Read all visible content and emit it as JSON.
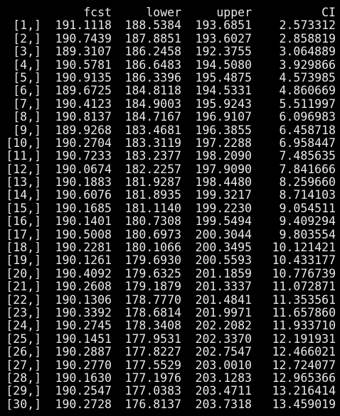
{
  "console": {
    "headers": [
      "",
      "fcst",
      "lower",
      "upper",
      "CI"
    ],
    "rows": [
      [
        "[1,]",
        "191.1118",
        "188.5384",
        "193.6851",
        "2.573312"
      ],
      [
        "[2,]",
        "190.7439",
        "187.8851",
        "193.6027",
        "2.858819"
      ],
      [
        "[3,]",
        "189.3107",
        "186.2458",
        "192.3755",
        "3.064889"
      ],
      [
        "[4,]",
        "190.5781",
        "186.6483",
        "194.5080",
        "3.929866"
      ],
      [
        "[5,]",
        "190.9135",
        "186.3396",
        "195.4875",
        "4.573985"
      ],
      [
        "[6,]",
        "189.6725",
        "184.8118",
        "194.5331",
        "4.860669"
      ],
      [
        "[7,]",
        "190.4123",
        "184.9003",
        "195.9243",
        "5.511997"
      ],
      [
        "[8,]",
        "190.8137",
        "184.7167",
        "196.9107",
        "6.096983"
      ],
      [
        "[9,]",
        "189.9268",
        "183.4681",
        "196.3855",
        "6.458718"
      ],
      [
        "[10,]",
        "190.2704",
        "183.3119",
        "197.2288",
        "6.958447"
      ],
      [
        "[11,]",
        "190.7233",
        "183.2377",
        "198.2090",
        "7.485635"
      ],
      [
        "[12,]",
        "190.0674",
        "182.2257",
        "197.9090",
        "7.841666"
      ],
      [
        "[13,]",
        "190.1883",
        "181.9287",
        "198.4480",
        "8.259660"
      ],
      [
        "[14,]",
        "190.6076",
        "181.8935",
        "199.3217",
        "8.714103"
      ],
      [
        "[15,]",
        "190.1685",
        "181.1140",
        "199.2230",
        "9.054511"
      ],
      [
        "[16,]",
        "190.1401",
        "180.7308",
        "199.5494",
        "9.409294"
      ],
      [
        "[17,]",
        "190.5008",
        "180.6973",
        "200.3044",
        "9.803554"
      ],
      [
        "[18,]",
        "190.2281",
        "180.1066",
        "200.3495",
        "10.121421"
      ],
      [
        "[19,]",
        "190.1261",
        "179.6930",
        "200.5593",
        "10.433177"
      ],
      [
        "[20,]",
        "190.4092",
        "179.6325",
        "201.1859",
        "10.776739"
      ],
      [
        "[21,]",
        "190.2608",
        "179.1879",
        "201.3337",
        "11.072871"
      ],
      [
        "[22,]",
        "190.1306",
        "178.7770",
        "201.4841",
        "11.353561"
      ],
      [
        "[23,]",
        "190.3392",
        "178.6814",
        "201.9971",
        "11.657860"
      ],
      [
        "[24,]",
        "190.2745",
        "178.3408",
        "202.2082",
        "11.933710"
      ],
      [
        "[25,]",
        "190.1451",
        "177.9531",
        "202.3370",
        "12.191931"
      ],
      [
        "[26,]",
        "190.2887",
        "177.8227",
        "202.7547",
        "12.466021"
      ],
      [
        "[27,]",
        "190.2770",
        "177.5529",
        "203.0010",
        "12.724077"
      ],
      [
        "[28,]",
        "190.1630",
        "177.1976",
        "203.1283",
        "12.965366"
      ],
      [
        "[29,]",
        "190.2547",
        "177.0383",
        "203.4711",
        "13.216414"
      ],
      [
        "[30,]",
        "190.2728",
        "176.8137",
        "203.7318",
        "13.459019"
      ]
    ]
  }
}
